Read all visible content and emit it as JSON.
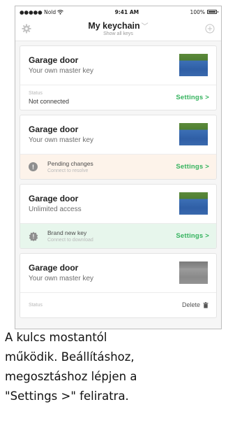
{
  "status_bar": {
    "carrier": "●●●●● Nold",
    "time": "9:41 AM",
    "battery": "100%"
  },
  "nav": {
    "title": "My keychain",
    "subtitle": "Show all keys",
    "left_icon": "gear-icon",
    "right_icon": "add-circle-icon"
  },
  "keys": [
    {
      "name": "Garage door",
      "desc": "Your own master key",
      "status_label": "Status",
      "status_value": "Not connected",
      "action": "Settings >"
    },
    {
      "name": "Garage door",
      "desc": "Your own master key",
      "message_title": "Pending changes",
      "message_sub": "Connect to resolve",
      "action": "Settings >"
    },
    {
      "name": "Garage door",
      "desc": "Unlimited access",
      "message_title": "Brand new key",
      "message_sub": "Connect to download",
      "action": "Settings >"
    },
    {
      "name": "Garage door",
      "desc": "Your own master key",
      "status_label": "Status",
      "action": "Delete"
    }
  ],
  "colors": {
    "accent_green": "#35b35e",
    "pending_bg": "#fdf3ea",
    "newkey_bg": "#e7f6ec"
  },
  "caption": {
    "line1": "A kulcs mostantól",
    "line2": "működik. Beállításhoz,",
    "line3": "megosztáshoz lépjen a",
    "line4": "\"Settings >\" feliratra."
  }
}
